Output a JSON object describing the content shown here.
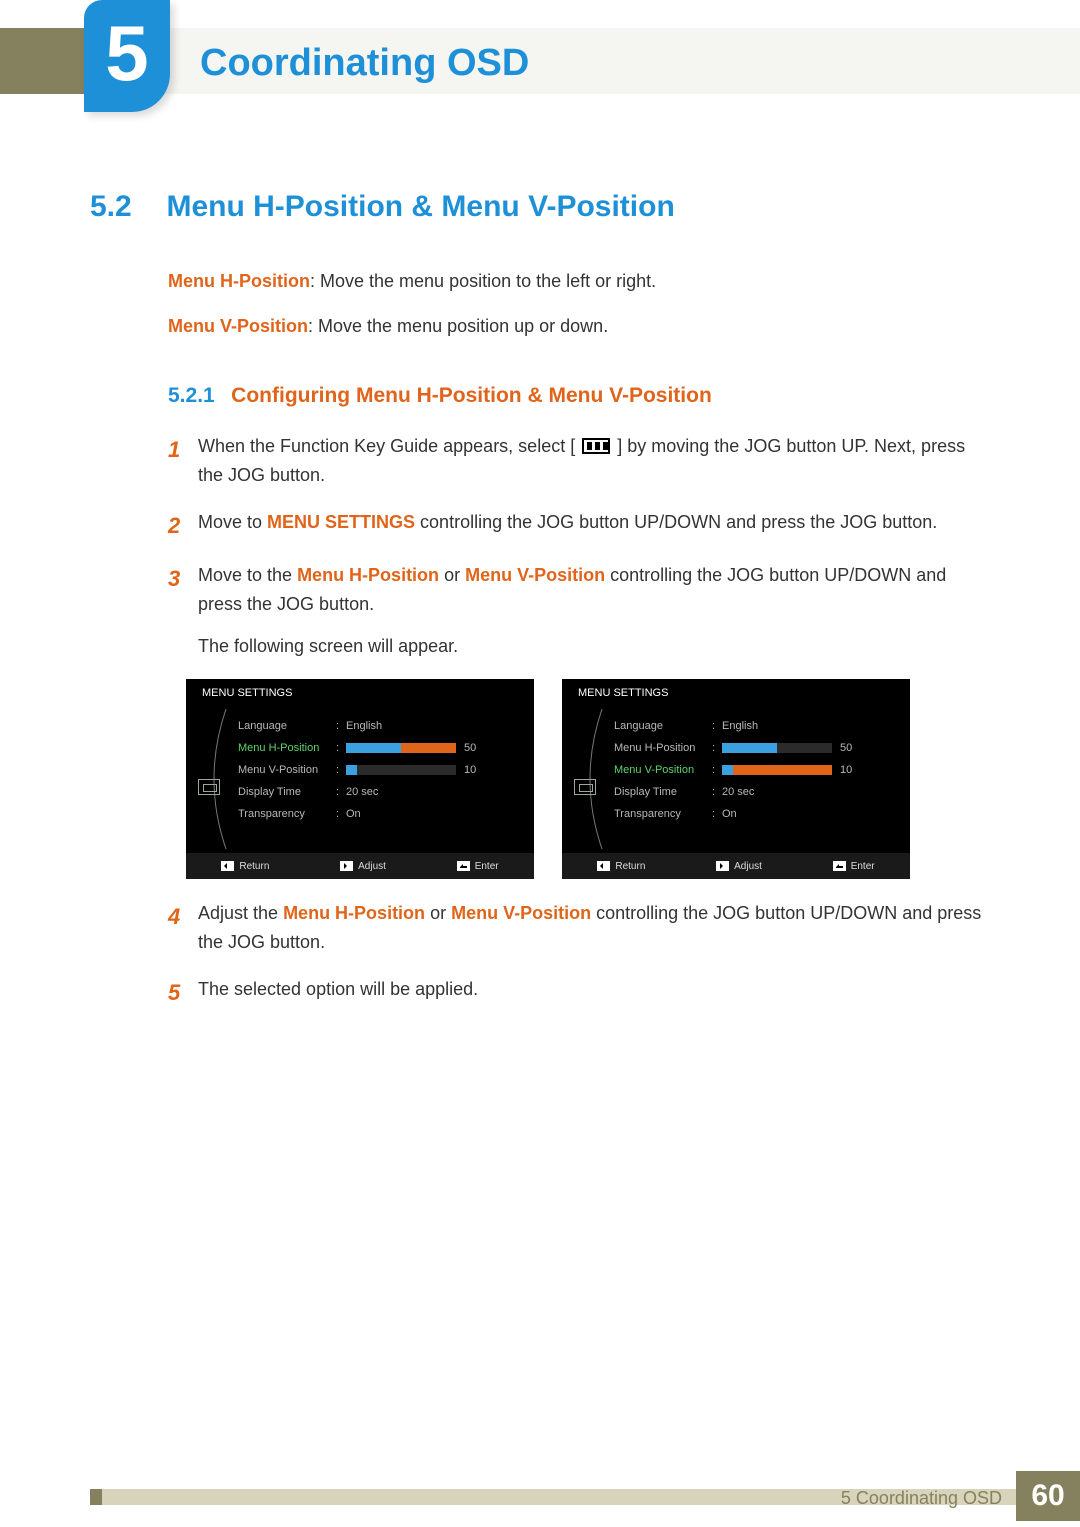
{
  "chapter": {
    "number": "5",
    "title": "Coordinating OSD"
  },
  "section": {
    "number": "5.2",
    "title": "Menu H-Position & Menu V-Position"
  },
  "intro": {
    "h_label": "Menu H-Position",
    "h_desc": ": Move the menu position to the left or right.",
    "v_label": "Menu V-Position",
    "v_desc": ": Move the menu position up or down."
  },
  "subsection": {
    "number": "5.2.1",
    "title": "Configuring Menu H-Position & Menu V-Position"
  },
  "steps": {
    "s1a": "When the Function Key Guide appears, select [",
    "s1b": "] by moving the JOG button UP. Next, press the JOG button.",
    "s2a": "Move to ",
    "s2hl": "MENU SETTINGS",
    "s2b": " controlling the JOG button UP/DOWN and press the JOG button.",
    "s3a": "Move to the ",
    "s3hl1": "Menu H-Position",
    "s3mid": " or ",
    "s3hl2": "Menu V-Position",
    "s3b": " controlling the JOG button UP/DOWN and press the JOG button.",
    "s3c": "The following screen will appear.",
    "s4a": "Adjust the ",
    "s4hl1": "Menu H-Position",
    "s4mid": " or ",
    "s4hl2": "Menu V-Position",
    "s4b": " controlling the JOG button UP/DOWN and press the JOG button.",
    "s5": "The selected option will be applied."
  },
  "step_nums": {
    "n1": "1",
    "n2": "2",
    "n3": "3",
    "n4": "4",
    "n5": "5"
  },
  "osd": {
    "title": "MENU SETTINGS",
    "rows": {
      "language": "Language",
      "hpos": "Menu H-Position",
      "vpos": "Menu V-Position",
      "dtime": "Display Time",
      "trans": "Transparency"
    },
    "vals": {
      "language": "English",
      "hpos": "50",
      "vpos": "10",
      "dtime": "20 sec",
      "trans": "On"
    },
    "foot": {
      "return": "Return",
      "adjust": "Adjust",
      "enter": "Enter"
    }
  },
  "footer": {
    "label": "5 Coordinating OSD",
    "page": "60"
  }
}
